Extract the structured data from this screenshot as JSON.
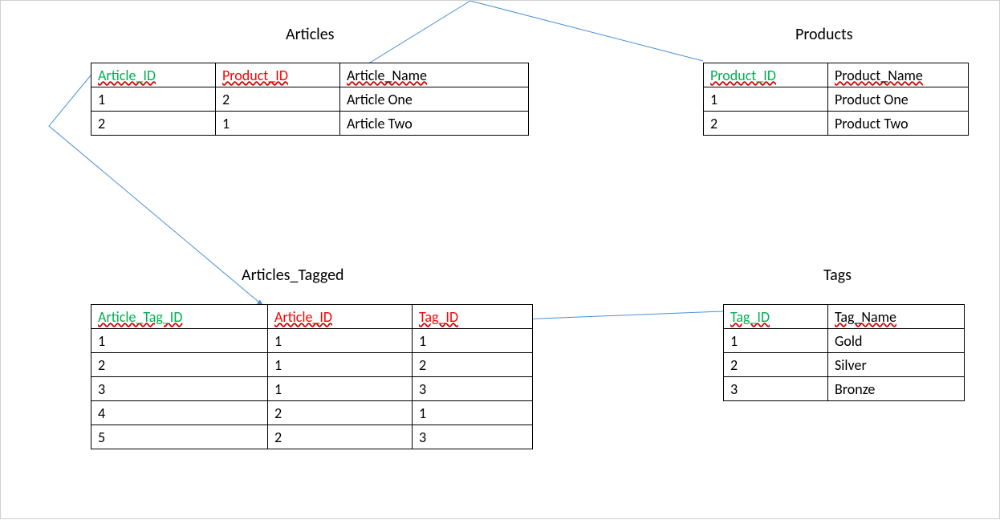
{
  "titles": {
    "articles": "Articles",
    "products": "Products",
    "articles_tagged": "Articles_Tagged",
    "tags": "Tags"
  },
  "articles": {
    "headers": [
      "Article_ID",
      "Product_ID",
      "Article_Name"
    ],
    "header_roles": [
      "pk",
      "fk",
      "nm"
    ],
    "rows": [
      [
        "1",
        "2",
        "Article One"
      ],
      [
        "2",
        "1",
        "Article Two"
      ]
    ]
  },
  "products": {
    "headers": [
      "Product_ID",
      "Product_Name"
    ],
    "header_roles": [
      "pk",
      "nm"
    ],
    "rows": [
      [
        "1",
        "Product One"
      ],
      [
        "2",
        "Product Two"
      ]
    ]
  },
  "articles_tagged": {
    "headers": [
      "Article_Tag_ID",
      "Article_ID",
      "Tag_ID"
    ],
    "header_roles": [
      "pk",
      "fk",
      "fk"
    ],
    "rows": [
      [
        "1",
        "1",
        "1"
      ],
      [
        "2",
        "1",
        "2"
      ],
      [
        "3",
        "1",
        "3"
      ],
      [
        "4",
        "2",
        "1"
      ],
      [
        "5",
        "2",
        "3"
      ]
    ]
  },
  "tags": {
    "headers": [
      "Tag_ID",
      "Tag_Name"
    ],
    "header_roles": [
      "pk",
      "nm"
    ],
    "rows": [
      [
        "1",
        "Gold"
      ],
      [
        "2",
        "Silver"
      ],
      [
        "3",
        "Bronze"
      ]
    ]
  },
  "chart_data": {
    "type": "table",
    "description": "Entity-relationship diagram with four tables and three foreign-key relations",
    "tables": [
      {
        "name": "Articles",
        "pk": "Article_ID",
        "fks": [
          "Product_ID"
        ],
        "columns": [
          "Article_ID",
          "Product_ID",
          "Article_Name"
        ]
      },
      {
        "name": "Products",
        "pk": "Product_ID",
        "fks": [],
        "columns": [
          "Product_ID",
          "Product_Name"
        ]
      },
      {
        "name": "Articles_Tagged",
        "pk": "Article_Tag_ID",
        "fks": [
          "Article_ID",
          "Tag_ID"
        ],
        "columns": [
          "Article_Tag_ID",
          "Article_ID",
          "Tag_ID"
        ]
      },
      {
        "name": "Tags",
        "pk": "Tag_ID",
        "fks": [],
        "columns": [
          "Tag_ID",
          "Tag_Name"
        ]
      }
    ],
    "relations": [
      {
        "from_table": "Articles",
        "from_col": "Product_ID",
        "to_table": "Products",
        "to_col": "Product_ID"
      },
      {
        "from_table": "Articles_Tagged",
        "from_col": "Article_ID",
        "to_table": "Articles",
        "to_col": "Article_ID"
      },
      {
        "from_table": "Articles_Tagged",
        "from_col": "Tag_ID",
        "to_table": "Tags",
        "to_col": "Tag_ID"
      }
    ]
  },
  "colors": {
    "pk": "#00b050",
    "fk": "#ff0000",
    "arrow": "#4a90d9"
  }
}
